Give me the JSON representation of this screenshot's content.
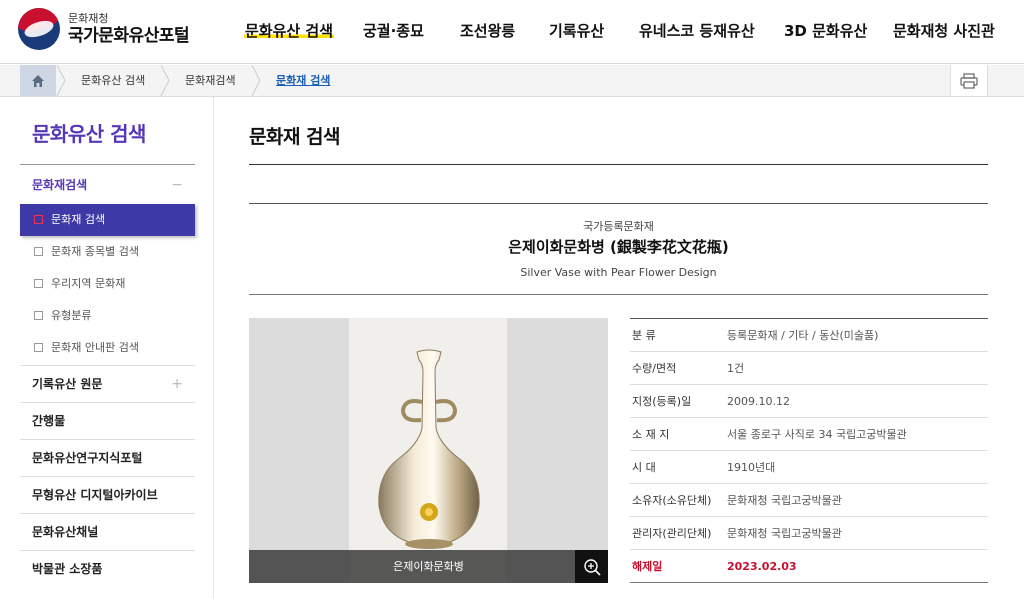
{
  "header": {
    "logo_small": "문화재청",
    "logo_big": "국가문화유산포털",
    "nav": [
      {
        "label": "문화유산 검색",
        "active": true
      },
      {
        "label": "궁궐·종묘"
      },
      {
        "label": "조선왕릉"
      },
      {
        "label": "기록유산"
      },
      {
        "label": "유네스코 등재유산"
      },
      {
        "label": "3D 문화유산"
      },
      {
        "label": "문화재청 사진관"
      }
    ]
  },
  "breadcrumb": {
    "items": [
      "문화유산 검색",
      "문화재검색",
      "문화재 검색"
    ]
  },
  "sidebar": {
    "title": "문화유산 검색",
    "group": {
      "label": "문화재검색",
      "toggle": "−",
      "items": [
        {
          "label": "문화재 검색",
          "active": true
        },
        {
          "label": "문화재 종목별 검색"
        },
        {
          "label": "우리지역 문화재"
        },
        {
          "label": "유형분류"
        },
        {
          "label": "문화재 안내판 검색"
        }
      ]
    },
    "menus": [
      {
        "label": "기록유산 원문",
        "toggle": "+"
      },
      {
        "label": "간행물"
      },
      {
        "label": "문화유산연구지식포털"
      },
      {
        "label": "무형유산 디지털아카이브"
      },
      {
        "label": "문화유산채널"
      },
      {
        "label": "박물관 소장품"
      }
    ]
  },
  "main": {
    "page_title": "문화재 검색",
    "designation": "국가등록문화재",
    "name_ko": "은제이화문화병 (銀製李花文花甁)",
    "name_en": "Silver Vase with Pear Flower Design",
    "photo_caption": "은제이화문화병",
    "info": [
      {
        "label": "분 류",
        "value": "등록문화재 / 기타 / 동산(미술품)"
      },
      {
        "label": "수량/면적",
        "value": "1건"
      },
      {
        "label": "지정(등록)일",
        "value": "2009.10.12"
      },
      {
        "label": "소 재 지",
        "value": "서울 종로구 사직로 34 국립고궁박물관"
      },
      {
        "label": "시 대",
        "value": "1910년대"
      },
      {
        "label": "소유자(소유단체)",
        "value": "문화재청 국립고궁박물관"
      },
      {
        "label": "관리자(관리단체)",
        "value": "문화재청 국립고궁박물관"
      },
      {
        "label": "해제일",
        "value": "2023.02.03",
        "highlight": true
      }
    ]
  },
  "colors": {
    "accent": "#5537b8",
    "active_menu": "#3d3aa8",
    "highlight": "#c8102e",
    "nav_underline": "#ffe100"
  }
}
